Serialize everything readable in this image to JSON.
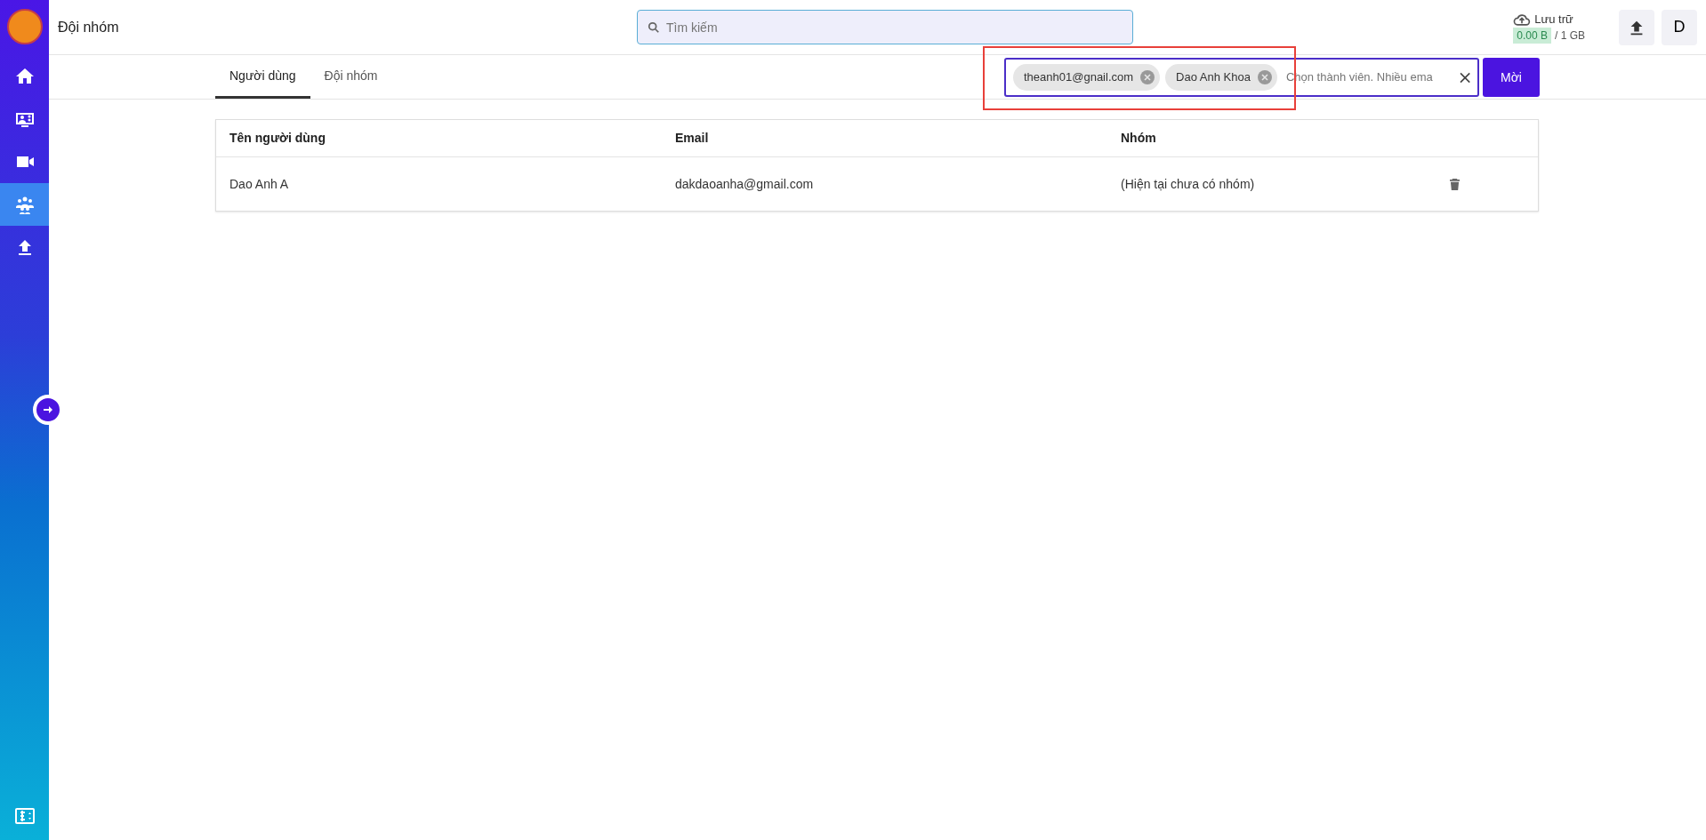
{
  "header": {
    "title": "Đội nhóm",
    "search": {
      "placeholder": "Tìm kiếm"
    },
    "storage": {
      "label": "Lưu trữ",
      "used": "0.00 B",
      "total": "/ 1 GB"
    },
    "avatar": "D"
  },
  "sidebar": {
    "items": [
      {
        "selected": false
      },
      {
        "selected": false
      },
      {
        "selected": false
      },
      {
        "selected": true
      },
      {
        "selected": false
      }
    ]
  },
  "tabs": [
    {
      "label": "Người dùng",
      "selected": true
    },
    {
      "label": "Đội nhóm",
      "selected": false
    }
  ],
  "invite": {
    "chips": [
      "theanh01@gnail.com",
      "Dao Anh Khoa"
    ],
    "placeholder": "Chọn thành viên. Nhiều ema",
    "button": "Mời"
  },
  "table": {
    "columns": [
      "Tên người dùng",
      "Email",
      "Nhóm"
    ],
    "rows": [
      {
        "cells": [
          "Dao Anh A",
          "dakdaoanha@gmail.com",
          "(Hiện tại chưa có nhóm)"
        ]
      }
    ]
  }
}
